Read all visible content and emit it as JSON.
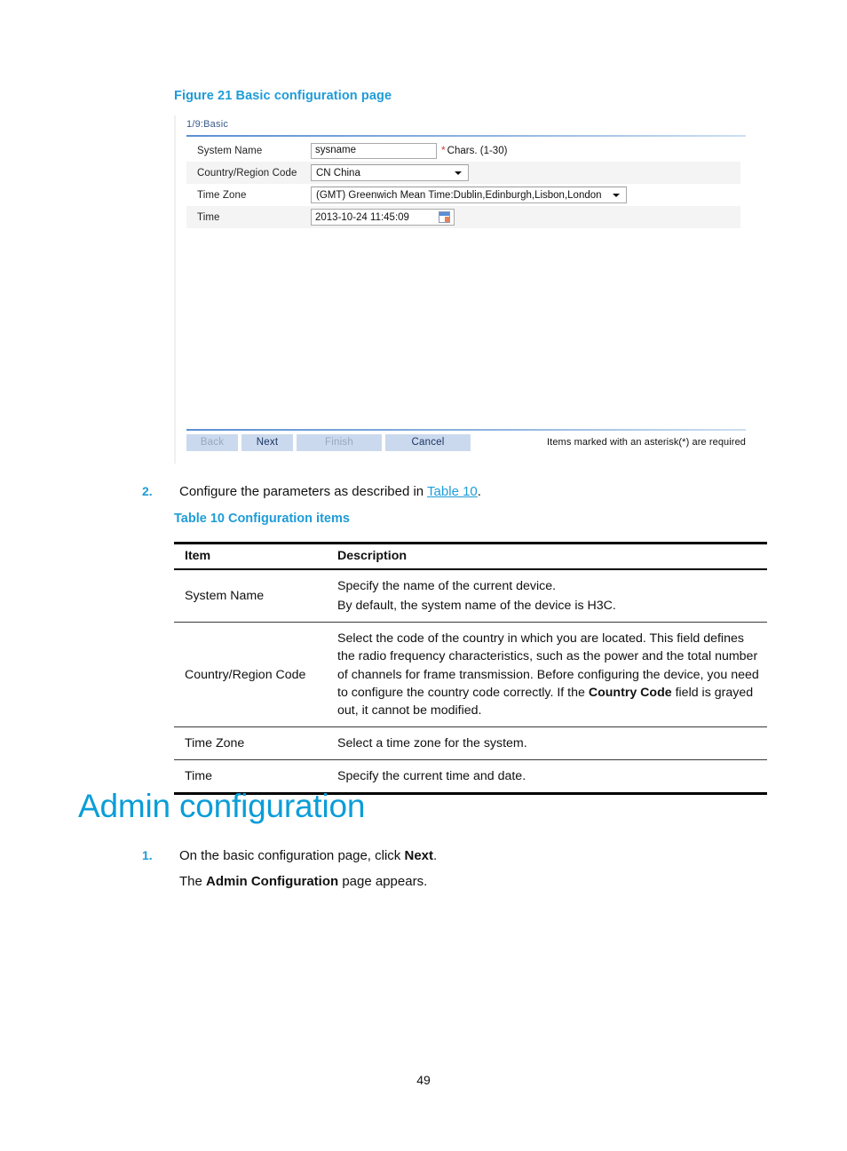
{
  "figure": {
    "caption": "Figure 21 Basic configuration page",
    "panel_title": "1/9:Basic",
    "rows": [
      {
        "label": "System Name",
        "type": "text",
        "value": "sysname",
        "required_mark": "*",
        "hint": "Chars. (1-30)"
      },
      {
        "label": "Country/Region Code",
        "type": "select",
        "value": "CN China"
      },
      {
        "label": "Time Zone",
        "type": "select",
        "value": "(GMT) Greenwich Mean Time:Dublin,Edinburgh,Lisbon,London"
      },
      {
        "label": "Time",
        "type": "datetime",
        "value": "2013-10-24  11:45:09",
        "icon": "calendar-icon"
      }
    ],
    "buttons": [
      {
        "label": "Back",
        "enabled": false
      },
      {
        "label": "Next",
        "enabled": true
      },
      {
        "label": "Finish",
        "enabled": false
      },
      {
        "label": "Cancel",
        "enabled": true
      }
    ],
    "required_note": "Items marked with an asterisk(*) are required"
  },
  "step2": {
    "number": "2.",
    "text_before": "Configure the parameters as described in ",
    "link": "Table 10",
    "text_after": "."
  },
  "table10": {
    "caption": "Table 10 Configuration items",
    "headers": [
      "Item",
      "Description"
    ],
    "rows": [
      {
        "item": "System Name",
        "desc_lines": [
          "Specify the name of the current device.",
          "By default, the system name of the device is H3C."
        ]
      },
      {
        "item": "Country/Region Code",
        "desc_lines": [
          "Select the code of the country in which you are located. This field defines the radio frequency characteristics, such as the power and the total number of channels for frame transmission. Before configuring the device, you need to configure the country code correctly. If the <b>Country Code</b> field is grayed out, it cannot be modified."
        ]
      },
      {
        "item": "Time Zone",
        "desc_lines": [
          "Select a time zone for the system."
        ]
      },
      {
        "item": "Time",
        "desc_lines": [
          "Specify the current time and date."
        ]
      }
    ]
  },
  "section": {
    "heading": "Admin configuration",
    "step1_number": "1.",
    "step1_html": "On the basic configuration page, click <b>Next</b>.",
    "step1_sub_html": "The <b>Admin Configuration</b> page appears."
  },
  "page_number": "49",
  "colors": {
    "accent_blue": "#1e9cd7",
    "heading_blue": "#0b9dd8",
    "required_red": "#d33c2e",
    "button_bg": "#cbd9ee",
    "row_alt_bg": "#f4f4f4"
  }
}
